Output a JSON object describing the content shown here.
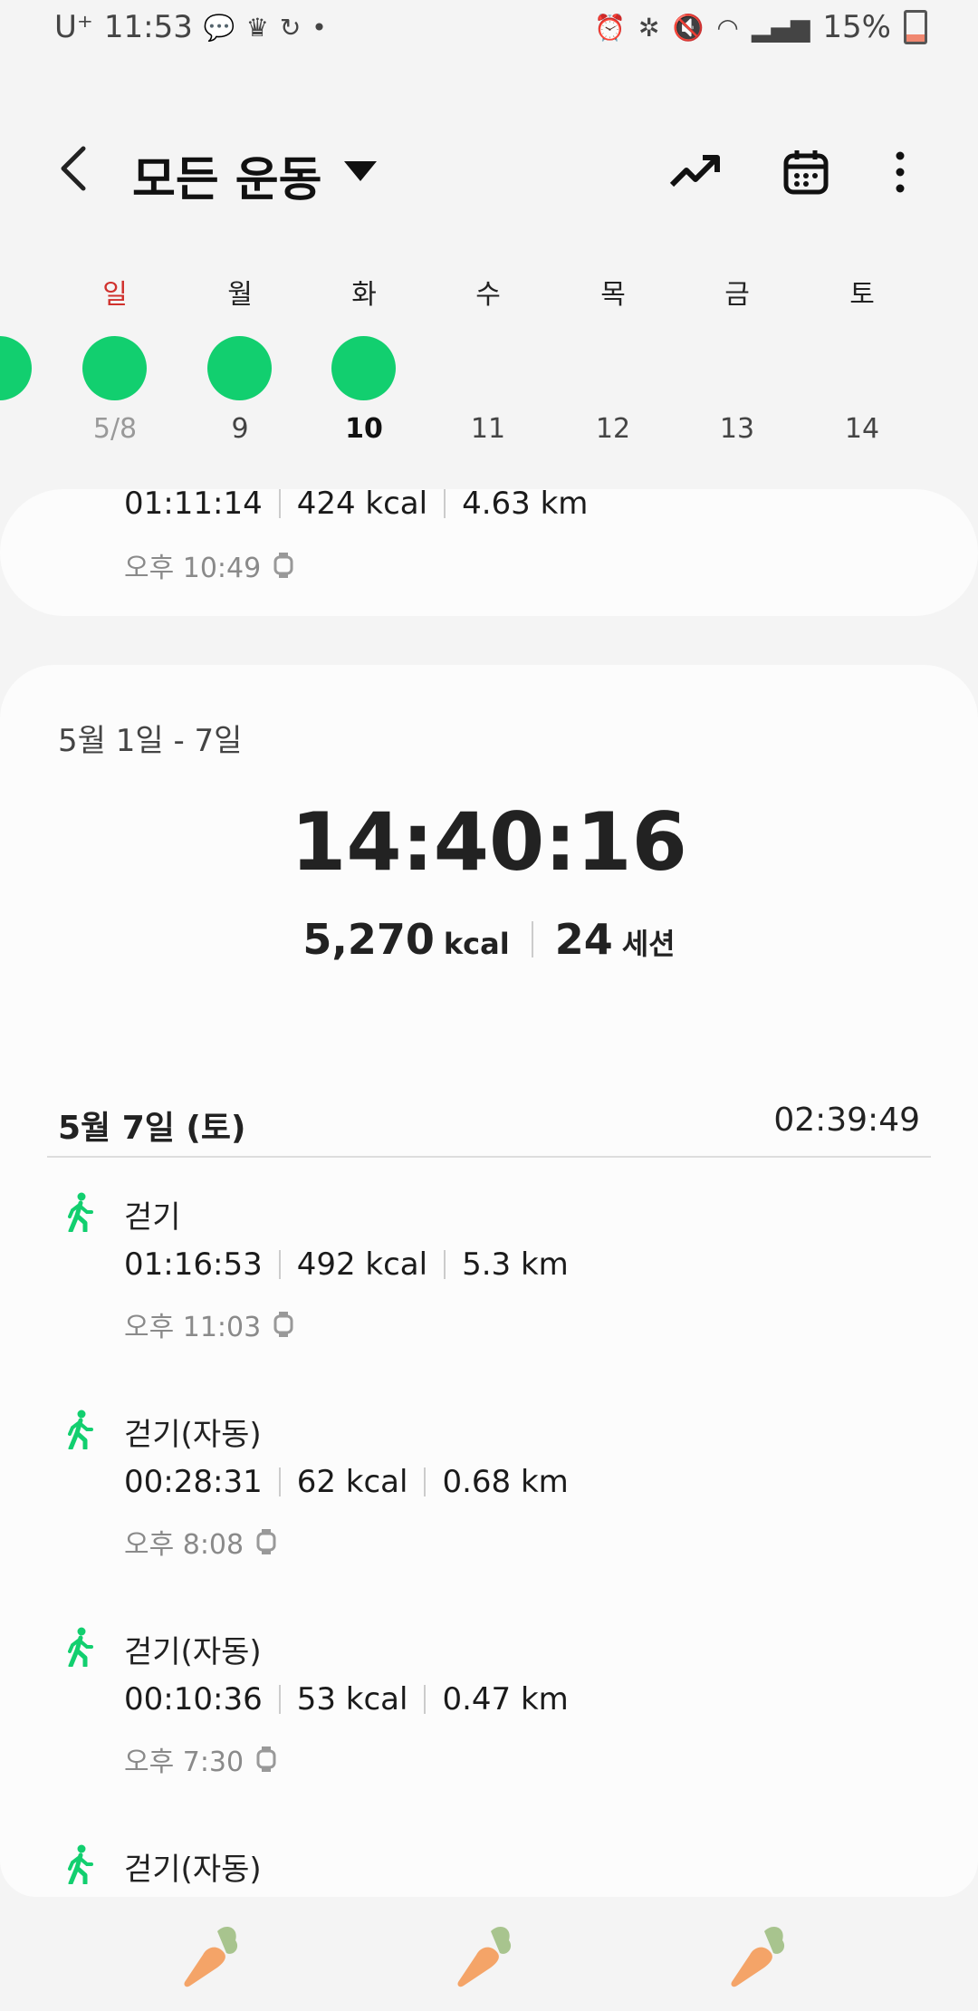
{
  "status_bar": {
    "carrier": "U⁺",
    "time": "11:53",
    "battery": "15%"
  },
  "header": {
    "title": "모든 운동"
  },
  "week": {
    "days": [
      {
        "weekday": "일",
        "date": "5/8",
        "done": true
      },
      {
        "weekday": "월",
        "date": "9",
        "done": true
      },
      {
        "weekday": "화",
        "date": "10",
        "done": true
      },
      {
        "weekday": "수",
        "date": "11",
        "done": false
      },
      {
        "weekday": "목",
        "date": "12",
        "done": false
      },
      {
        "weekday": "금",
        "date": "13",
        "done": false
      },
      {
        "weekday": "토",
        "date": "14",
        "done": false
      }
    ]
  },
  "prev_entry": {
    "duration": "01:11:14",
    "kcal": "424 kcal",
    "distance": "4.63 km",
    "time": "오후 10:49"
  },
  "summary": {
    "range": "5월 1일 - 7일",
    "total_time": "14:40:16",
    "kcal_value": "5,270",
    "kcal_unit": "kcal",
    "sessions_value": "24",
    "sessions_unit": "세션"
  },
  "day_group": {
    "label": "5월 7일 (토)",
    "total": "02:39:49"
  },
  "entries": [
    {
      "name": "걷기",
      "duration": "01:16:53",
      "kcal": "492 kcal",
      "distance": "5.3 km",
      "time": "오후 11:03"
    },
    {
      "name": "걷기(자동)",
      "duration": "00:28:31",
      "kcal": "62 kcal",
      "distance": "0.68 km",
      "time": "오후 8:08"
    },
    {
      "name": "걷기(자동)",
      "duration": "00:10:36",
      "kcal": "53 kcal",
      "distance": "0.47 km",
      "time": "오후 7:30"
    },
    {
      "name": "걷기(자동)"
    }
  ],
  "colors": {
    "accent_green": "#12cf6f",
    "sunday_red": "#d0312d"
  },
  "icons": [
    "back-arrow-icon",
    "dropdown-arrow-icon",
    "trend-icon",
    "calendar-icon",
    "more-icon",
    "walk-icon",
    "watch-icon",
    "carrot-icon"
  ]
}
